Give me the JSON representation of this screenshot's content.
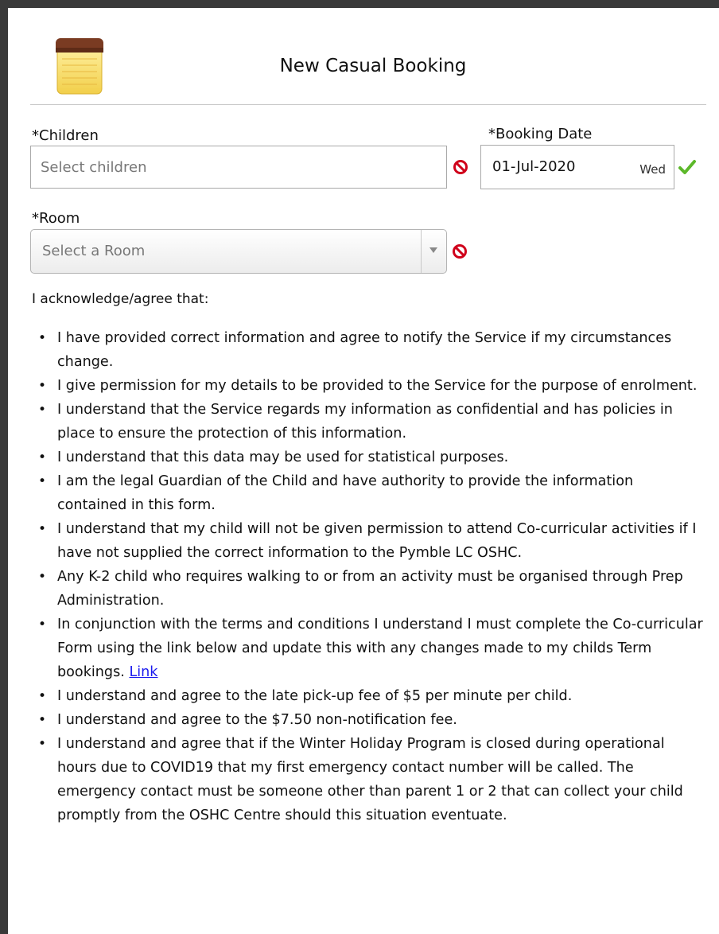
{
  "header": {
    "title": "New Casual Booking"
  },
  "children": {
    "label": "*Children",
    "placeholder": "Select children"
  },
  "booking_date": {
    "label": "*Booking Date",
    "value": "01-Jul-2020",
    "day": "Wed"
  },
  "room": {
    "label": "*Room",
    "placeholder": "Select a Room"
  },
  "acknowledge": {
    "heading": "I acknowledge/agree that:",
    "items": [
      "I have provided correct information and agree to notify the Service if my circumstances change.",
      "I give permission for my details to be provided to the Service for the purpose of enrolment.",
      "I understand that the Service regards my information as confidential and has policies in place to ensure the protection of this information.",
      "I understand that this data may be used for statistical purposes.",
      "I am the legal Guardian of the Child and have authority to provide the information contained in this form.",
      "I understand that my child will not be given permission to attend Co-curricular activities if I have not supplied the correct information to the Pymble LC OSHC.",
      "Any K-2 child who requires walking to or from an activity must be organised through Prep Administration.",
      "In conjunction with the terms and conditions I understand I must complete the Co-curricular Form using the link below and update this with any changes made to my childs Term bookings.",
      "I understand and agree to the late pick-up fee of $5 per minute per child.",
      "I understand and agree to the $7.50 non-notification fee.",
      "I understand and agree that if the Winter Holiday Program is closed during operational hours due to COVID19 that my first emergency contact number will be called. The emergency contact must be someone other than parent 1 or 2 that can collect your child promptly from the OSHC Centre should this situation eventuate."
    ],
    "link_label": "Link"
  },
  "icons": {
    "header": "notepad-icon",
    "invalid": "no-entry-icon",
    "valid": "checkmark-icon"
  },
  "colors": {
    "link": "#1a1aee",
    "invalid": "#d0021b",
    "valid": "#5cb82a"
  }
}
